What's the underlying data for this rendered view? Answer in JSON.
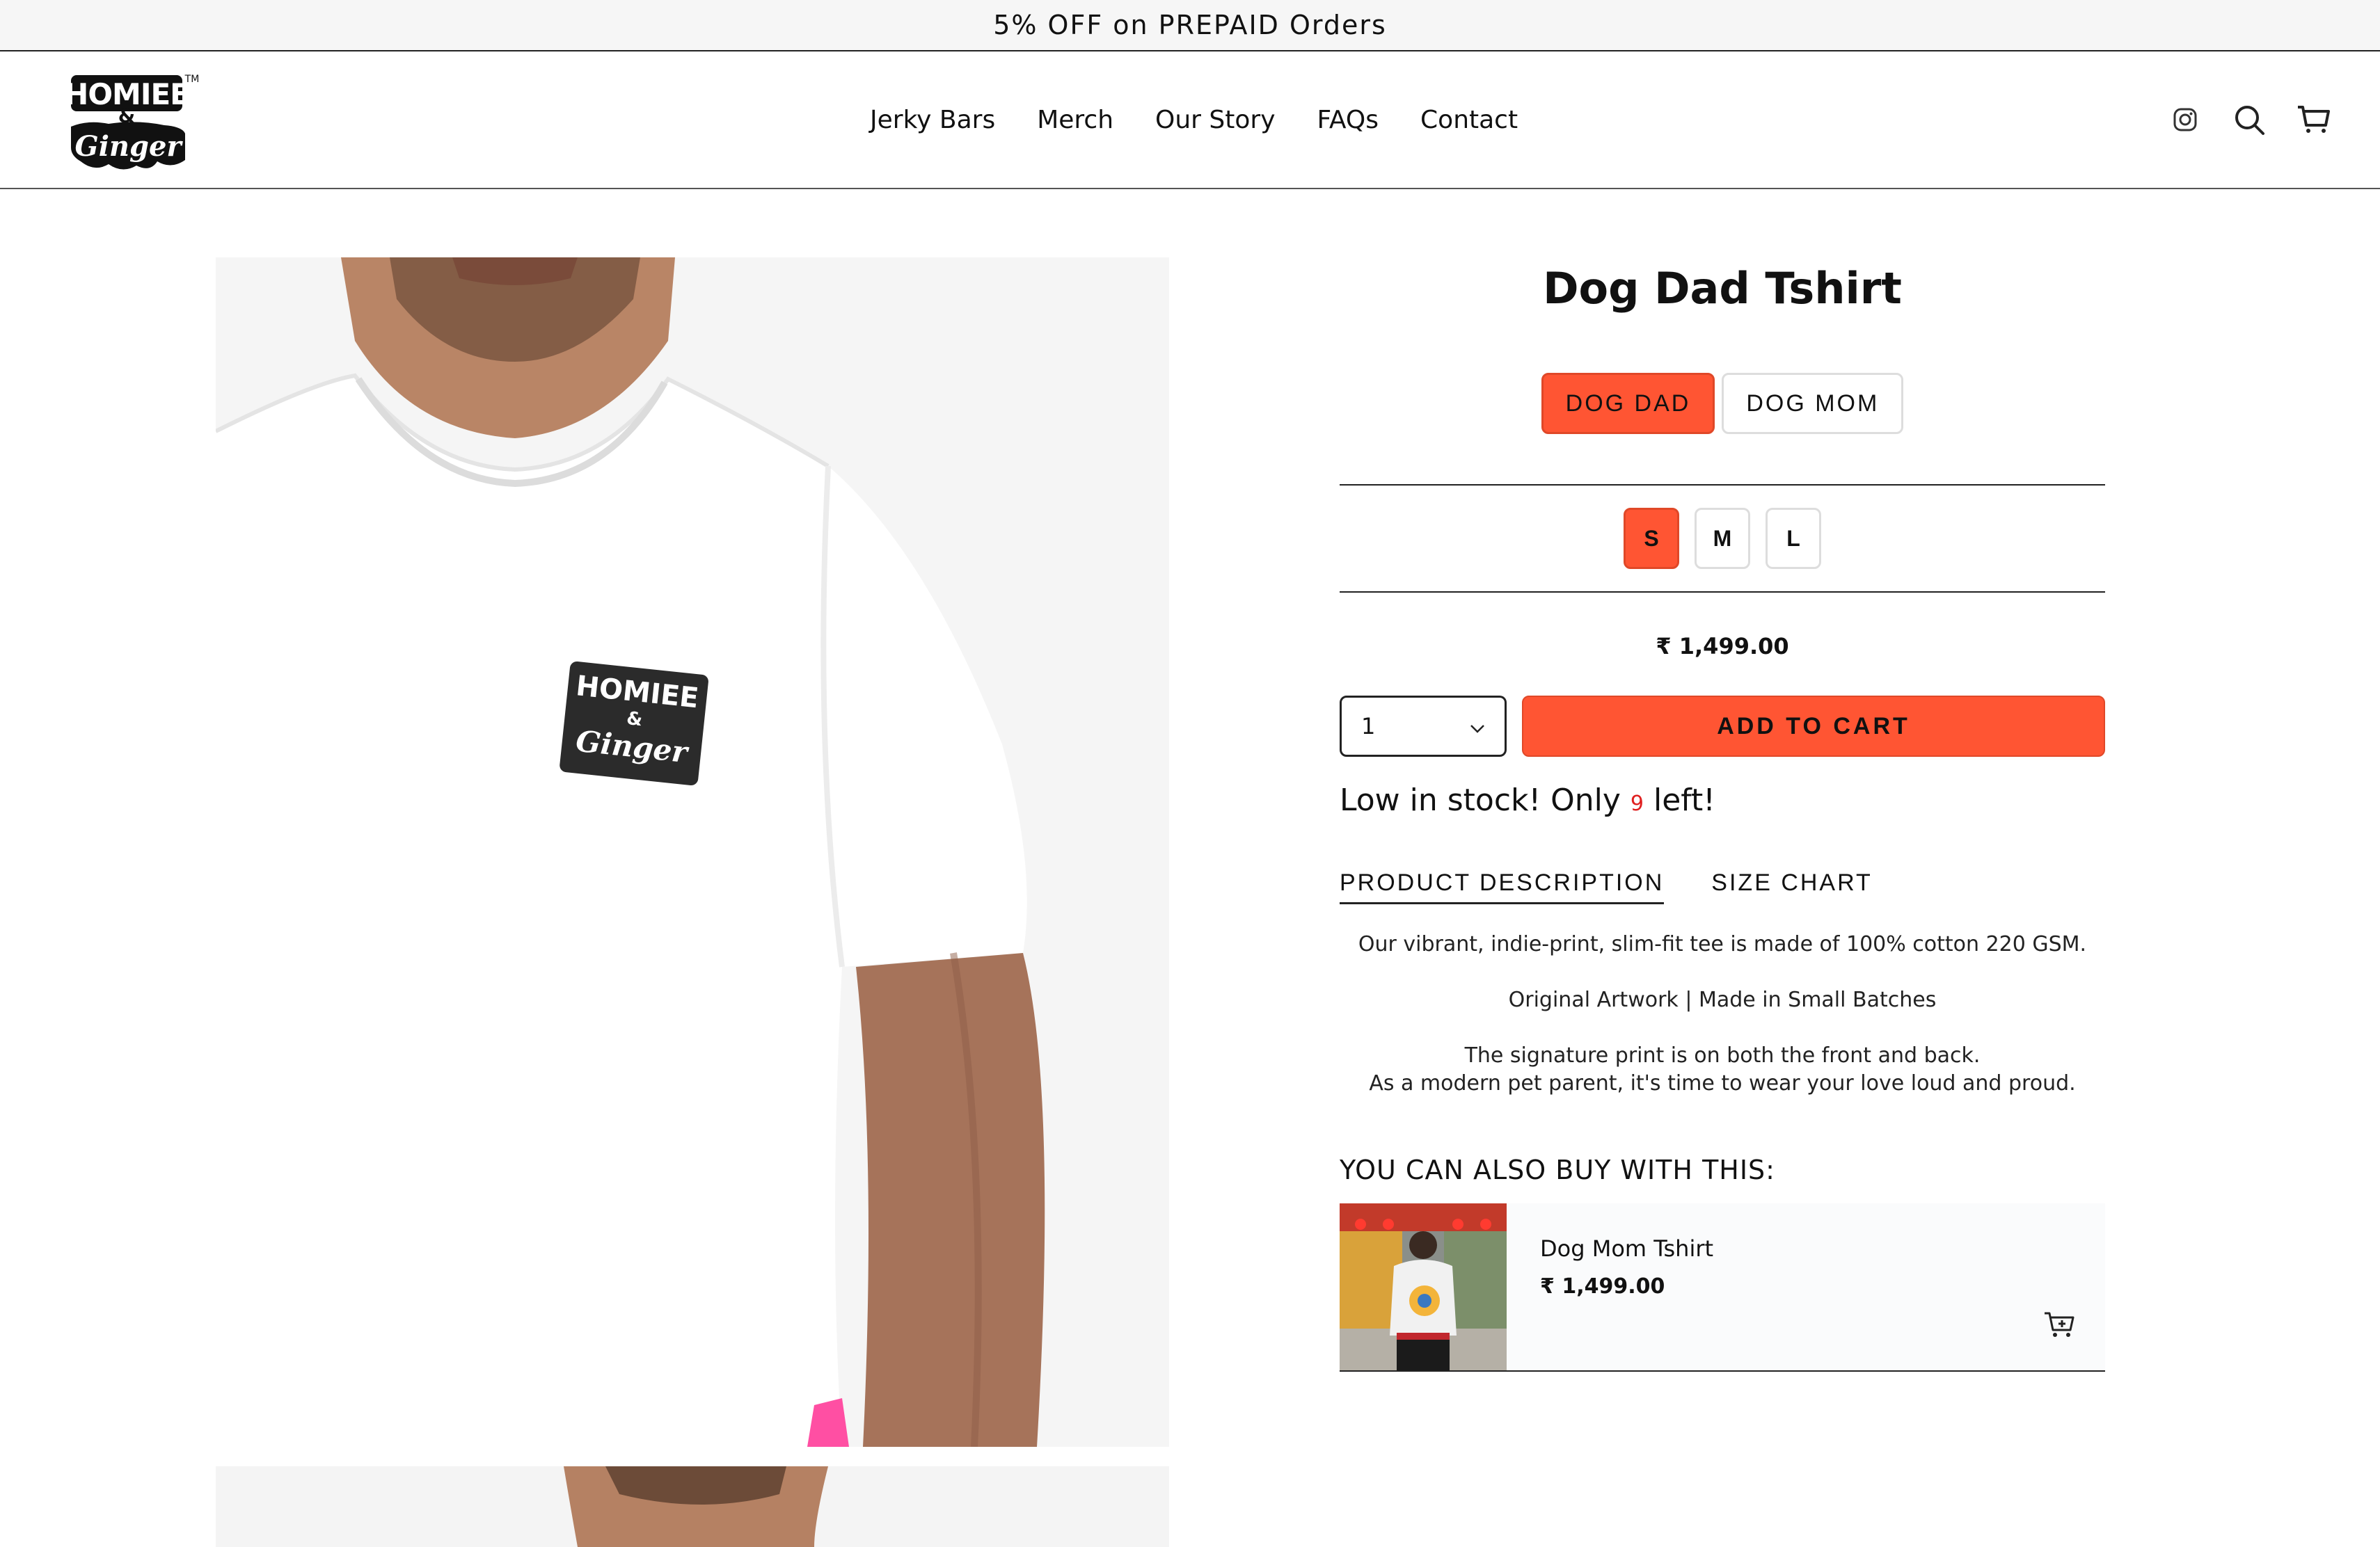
{
  "announcement": "5% OFF on PREPAID Orders",
  "brand": {
    "name": "Homiee & Ginger",
    "logo_line1": "HOMIEE",
    "logo_amp": "&",
    "logo_line2": "Ginger",
    "trademark": "TM"
  },
  "nav": {
    "items": [
      {
        "label": "Jerky Bars"
      },
      {
        "label": "Merch"
      },
      {
        "label": "Our Story"
      },
      {
        "label": "FAQs"
      },
      {
        "label": "Contact"
      }
    ]
  },
  "header_icons": [
    "instagram-icon",
    "search-icon",
    "cart-icon"
  ],
  "product": {
    "title": "Dog Dad Tshirt",
    "styles": [
      {
        "label": "DOG DAD",
        "selected": true
      },
      {
        "label": "DOG MOM",
        "selected": false
      }
    ],
    "sizes": [
      {
        "label": "S",
        "selected": true
      },
      {
        "label": "M",
        "selected": false
      },
      {
        "label": "L",
        "selected": false
      }
    ],
    "price": "₹ 1,499.00",
    "quantity": "1",
    "add_to_cart": "ADD TO CART",
    "stock_prefix": "Low in stock! Only",
    "stock_count": "9",
    "stock_suffix": "left!",
    "tabs": [
      {
        "label": "PRODUCT DESCRIPTION",
        "active": true
      },
      {
        "label": "SIZE CHART",
        "active": false
      }
    ],
    "description": {
      "p1": "Our vibrant, indie-print, slim-fit tee is made of 100% cotton 220 GSM.",
      "p2": "Original Artwork | Made in Small Batches",
      "p3_line1": "The signature print is on both the front and back.",
      "p3_line2": "As a modern pet parent, it's time to wear your love loud and proud."
    }
  },
  "also_buy": {
    "title": "YOU CAN ALSO BUY WITH THIS:",
    "items": [
      {
        "name": "Dog Mom Tshirt",
        "price": "₹ 1,499.00"
      }
    ]
  },
  "colors": {
    "accent": "#ff5533",
    "stock_number": "#e02020",
    "text": "#111111"
  }
}
